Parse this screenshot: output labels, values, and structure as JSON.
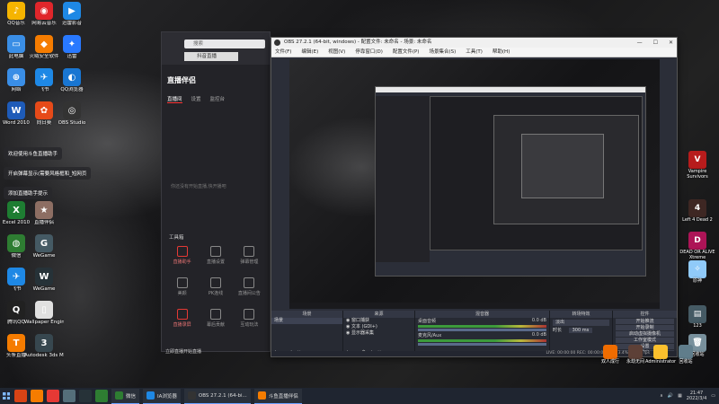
{
  "desktop_icons_left": [
    {
      "label": "QQ音乐",
      "color": "#f5b400",
      "glyph": "♪",
      "icon": "music-icon"
    },
    {
      "label": "网易云音乐",
      "color": "#e0262b",
      "glyph": "◉",
      "icon": "netease-music-icon"
    },
    {
      "label": "迅雷影音",
      "color": "#1e88e5",
      "glyph": "▶",
      "icon": "video-player-icon"
    },
    {
      "label": "此电脑",
      "color": "#3a8ee6",
      "glyph": "▭",
      "icon": "computer-icon"
    },
    {
      "label": "火绒安全软件",
      "color": "#f57c00",
      "glyph": "◆",
      "icon": "shield-icon"
    },
    {
      "label": "迅雷",
      "color": "#2979ff",
      "glyph": "✦",
      "icon": "thunder-icon"
    },
    {
      "label": "网络",
      "color": "#3a8ee6",
      "glyph": "⊕",
      "icon": "network-icon"
    },
    {
      "label": "飞书",
      "color": "#1e88e5",
      "glyph": "✈",
      "icon": "feishu-icon"
    },
    {
      "label": "QQ浏览器",
      "color": "#1976d2",
      "glyph": "◐",
      "icon": "browser-icon"
    },
    {
      "label": "Word 2010",
      "color": "#1e5bb8",
      "glyph": "W",
      "icon": "word-icon"
    },
    {
      "label": "向日葵",
      "color": "#e64a19",
      "glyph": "✿",
      "icon": "remote-icon"
    },
    {
      "label": "OBS Studio",
      "color": "#333",
      "glyph": "◎",
      "icon": "obs-icon"
    },
    {
      "label": "Excel 2010",
      "color": "#1e7d32",
      "glyph": "X",
      "icon": "excel-icon"
    },
    {
      "label": "直播伴侣",
      "color": "#8d6e63",
      "glyph": "★",
      "icon": "live-icon"
    },
    {
      "label": "微信",
      "color": "#2e7d32",
      "glyph": "◍",
      "icon": "wechat-icon"
    },
    {
      "label": "WeGame",
      "color": "#455a64",
      "glyph": "G",
      "icon": "wegame-icon"
    },
    {
      "label": "飞书",
      "color": "#1e88e5",
      "glyph": "✈",
      "icon": "feishu-icon-2"
    },
    {
      "label": "WeGame",
      "color": "#263238",
      "glyph": "W",
      "icon": "wegame-icon-2"
    },
    {
      "label": "腾讯QQ",
      "color": "#212121",
      "glyph": "Q",
      "icon": "qq-icon"
    },
    {
      "label": "Wallpaper Engine",
      "color": "#e0e0e0",
      "glyph": "▯",
      "icon": "wallpaper-icon"
    },
    {
      "label": "头条直播",
      "color": "#f57c00",
      "glyph": "T",
      "icon": "toutiao-icon"
    },
    {
      "label": "Autodesk 3ds Max",
      "color": "#37474f",
      "glyph": "3",
      "icon": "3dsmax-icon"
    }
  ],
  "toasts": [
    "欢迎使用斗鱼直播助手",
    "开启弹幕显示(需要风格框和_短网页",
    "添加直播助手提示"
  ],
  "zbw": {
    "search_placeholder": "搜索",
    "camera_label": "抖音直播",
    "logo": "直播伴侣",
    "tabs": [
      "直播间",
      "设置",
      "监控台"
    ],
    "notice": "你还没有开始直播,快开播吧",
    "toolbox_title": "工具箱",
    "tools": [
      {
        "label": "直播助手",
        "red": true
      },
      {
        "label": "直播设置",
        "red": false
      },
      {
        "label": "弹幕管理",
        "red": false
      },
      {
        "label": "美颜",
        "red": false
      },
      {
        "label": "PK连线",
        "red": false
      },
      {
        "label": "直播间公告",
        "red": false
      },
      {
        "label": "直播录屏",
        "red": true
      },
      {
        "label": "幕后贡献",
        "red": false
      },
      {
        "label": "互动玩法",
        "red": false
      }
    ],
    "banner": "立即直播开始直播"
  },
  "obs": {
    "title": "OBS 27.2.1 (64-bit, windows) - 配置文件: 未命名 - 场景: 未命名",
    "menu": [
      "文件(F)",
      "编辑(E)",
      "视图(V)",
      "停靠窗口(D)",
      "配置文件(P)",
      "场景集合(S)",
      "工具(T)",
      "帮助(H)"
    ],
    "window_buttons": [
      "—",
      "☐",
      "✕"
    ],
    "docks": {
      "scenes_title": "场景",
      "scenes": [
        "场景"
      ],
      "sources_title": "来源",
      "sources": [
        "窗口捕获",
        "文本 (GDI+)",
        "显示器采集"
      ],
      "mixer_title": "混音器",
      "mixer": [
        {
          "name": "桌面音频",
          "db": "0.0 dB"
        },
        {
          "name": "麦克风/Aux",
          "db": "0.0 dB"
        }
      ],
      "transitions_title": "转场特效",
      "transition": "淡出",
      "duration_label": "时长",
      "duration": "300 ms",
      "controls_title": "控件",
      "controls": [
        "开始推流",
        "开始录制",
        "启动虚拟摄像机",
        "工作室模式",
        "设置",
        "退出"
      ]
    },
    "status": "LIVE: 00:00:00   REC: 00:00:00   CPU: 3.4%, 30.00 fps"
  },
  "desktop_icons_right": [
    {
      "label": "Vampire Survivors",
      "color": "#b71c1c",
      "glyph": "V"
    },
    {
      "label": "Left 4 Dead 2",
      "color": "#3e2723",
      "glyph": "4"
    },
    {
      "label": "DEAD OR ALIVE Xtreme",
      "color": "#ad1457",
      "glyph": "D"
    },
    {
      "label": "原神",
      "color": "#90caf9",
      "glyph": "✧"
    },
    {
      "label": "123",
      "color": "#455a64",
      "glyph": "▤"
    },
    {
      "label": "回收站",
      "color": "#78909c",
      "glyph": "🗑"
    }
  ],
  "bottom_icons": [
    {
      "label": "双人成行",
      "color": "#ef6c00"
    },
    {
      "label": "永劫无间",
      "color": "#5d4037"
    },
    {
      "label": "Administrator",
      "color": "#fbc02d"
    },
    {
      "label": "回收站",
      "color": "#607d8b"
    }
  ],
  "taskbar": {
    "pinned": [
      {
        "color": "#d84315",
        "name": "taskbar-pin-1"
      },
      {
        "color": "#f57c00",
        "name": "taskbar-pin-2"
      },
      {
        "color": "#e53935",
        "name": "taskbar-pin-3"
      },
      {
        "color": "#546e7a",
        "name": "taskbar-pin-4"
      },
      {
        "color": "#263238",
        "name": "taskbar-pin-5"
      },
      {
        "color": "#2e7d32",
        "name": "taskbar-pin-6"
      }
    ],
    "apps": [
      {
        "label": "微信",
        "color": "#2e7d32"
      },
      {
        "label": "IA浏览器",
        "color": "#1e88e5"
      },
      {
        "label": "OBS 27.2.1 (64-bi...",
        "color": "#333"
      },
      {
        "label": "斗鱼直播伴侣",
        "color": "#f57c00"
      }
    ],
    "time": "21:47",
    "date": "2022/3/4"
  }
}
